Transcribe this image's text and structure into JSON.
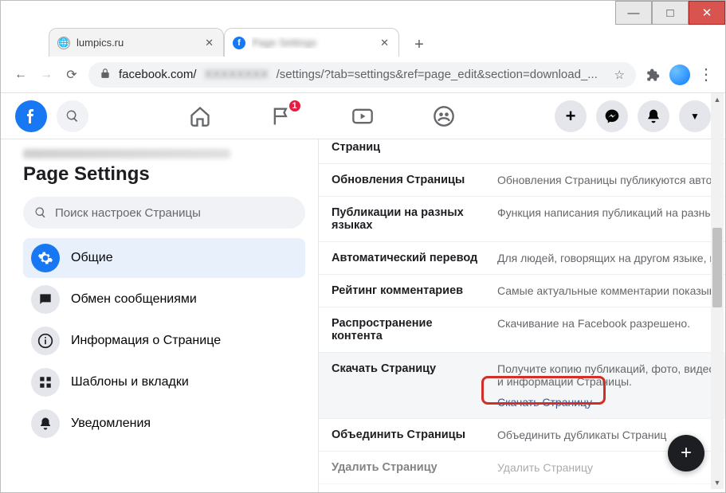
{
  "window": {
    "controls": {
      "minimize": "—",
      "maximize": "□",
      "close": "✕"
    }
  },
  "tabs": {
    "items": [
      {
        "favicon": "globe",
        "title": "lumpics.ru",
        "active": false
      },
      {
        "favicon": "fb",
        "title": "Page Settings",
        "active": true,
        "blurred": true
      }
    ],
    "new_tab": "+"
  },
  "addressbar": {
    "back": "←",
    "forward": "→",
    "reload": "⟳",
    "lock": "lock",
    "url_prefix": "facebook.com/",
    "url_blur": "XXXXXXXX",
    "url_suffix": "/settings/?tab=settings&ref=page_edit&section=download_...",
    "star": "☆",
    "menu": "⋮"
  },
  "fb_header": {
    "notifications_badge": "1"
  },
  "page": {
    "title": "Page Settings",
    "search_placeholder": "Поиск настроек Страницы"
  },
  "sidebar": {
    "items": [
      {
        "label": "Общие",
        "icon": "gear",
        "active": true
      },
      {
        "label": "Обмен сообщениями",
        "icon": "chat"
      },
      {
        "label": "Информация о Странице",
        "icon": "info"
      },
      {
        "label": "Шаблоны и вкладки",
        "icon": "grid"
      },
      {
        "label": "Уведомления",
        "icon": "bell"
      }
    ]
  },
  "settings_rows": [
    {
      "label": "Страниц",
      "desc": ""
    },
    {
      "label": "Обновления Страницы",
      "desc": "Обновления Страницы публикуются автоматически при достижении целей, получении отзывов и пр."
    },
    {
      "label": "Публикации на разных языках",
      "desc": "Функция написания публикаций на разных языках выключена."
    },
    {
      "label": "Автоматический перевод",
      "desc": "Для людей, говорящих на другом языке, можно показывать автоматический перевод."
    },
    {
      "label": "Рейтинг комментариев",
      "desc": "Самые актуальные комментарии показываются по умолчанию."
    },
    {
      "label": "Распространение контента",
      "desc": "Скачивание на Facebook разрешено."
    },
    {
      "label": "Скачать Страницу",
      "desc": "Получите копию публикаций, фото, видео и информации Страницы.",
      "link": "Скачать Страницу",
      "highlight": true
    },
    {
      "label": "Объединить Страницы",
      "desc": "Объединить дубликаты Страниц"
    },
    {
      "label": "Удалить Страницу",
      "desc": "Удалить Страницу"
    }
  ],
  "fab": "+"
}
